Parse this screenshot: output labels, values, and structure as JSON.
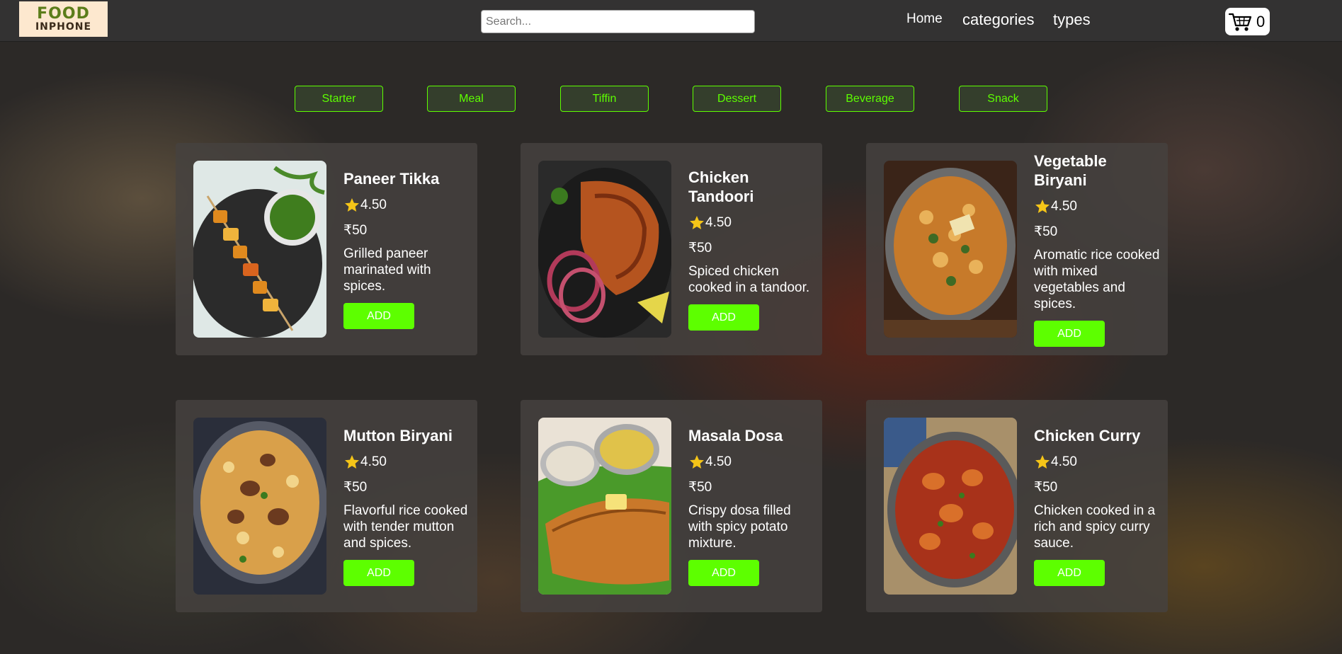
{
  "navbar": {
    "logo_line1": "FOOD",
    "logo_line2": "INPHONE",
    "search_placeholder": "Search...",
    "links": [
      "Home",
      "categories",
      "types"
    ],
    "cart_count": "0",
    "cart_icon": "cart-icon"
  },
  "filters": [
    "Starter",
    "Meal",
    "Tiffin",
    "Dessert",
    "Beverage",
    "Snack"
  ],
  "colors": {
    "accent": "#5dff00",
    "navbar_bg": "#333232",
    "card_bg": "#464240",
    "star": "#f5c518"
  },
  "cards": [
    {
      "title": "Paneer Tikka",
      "rating": "4.50",
      "price": "₹50",
      "description": "Grilled paneer marinated with spices.",
      "add_label": "ADD",
      "image": "paneer-tikka-image"
    },
    {
      "title": "Chicken Tandoori",
      "rating": "4.50",
      "price": "₹50",
      "description": "Spiced chicken cooked in a tandoor.",
      "add_label": "ADD",
      "image": "chicken-tandoori-image"
    },
    {
      "title": "Vegetable Biryani",
      "rating": "4.50",
      "price": "₹50",
      "description": "Aromatic rice cooked with mixed vegetables and spices.",
      "add_label": "ADD",
      "image": "vegetable-biryani-image"
    },
    {
      "title": "Mutton Biryani",
      "rating": "4.50",
      "price": "₹50",
      "description": "Flavorful rice cooked with tender mutton and spices.",
      "add_label": "ADD",
      "image": "mutton-biryani-image"
    },
    {
      "title": "Masala Dosa",
      "rating": "4.50",
      "price": "₹50",
      "description": "Crispy dosa filled with spicy potato mixture.",
      "add_label": "ADD",
      "image": "masala-dosa-image"
    },
    {
      "title": "Chicken Curry",
      "rating": "4.50",
      "price": "₹50",
      "description": "Chicken cooked in a rich and spicy curry sauce.",
      "add_label": "ADD",
      "image": "chicken-curry-image"
    }
  ]
}
